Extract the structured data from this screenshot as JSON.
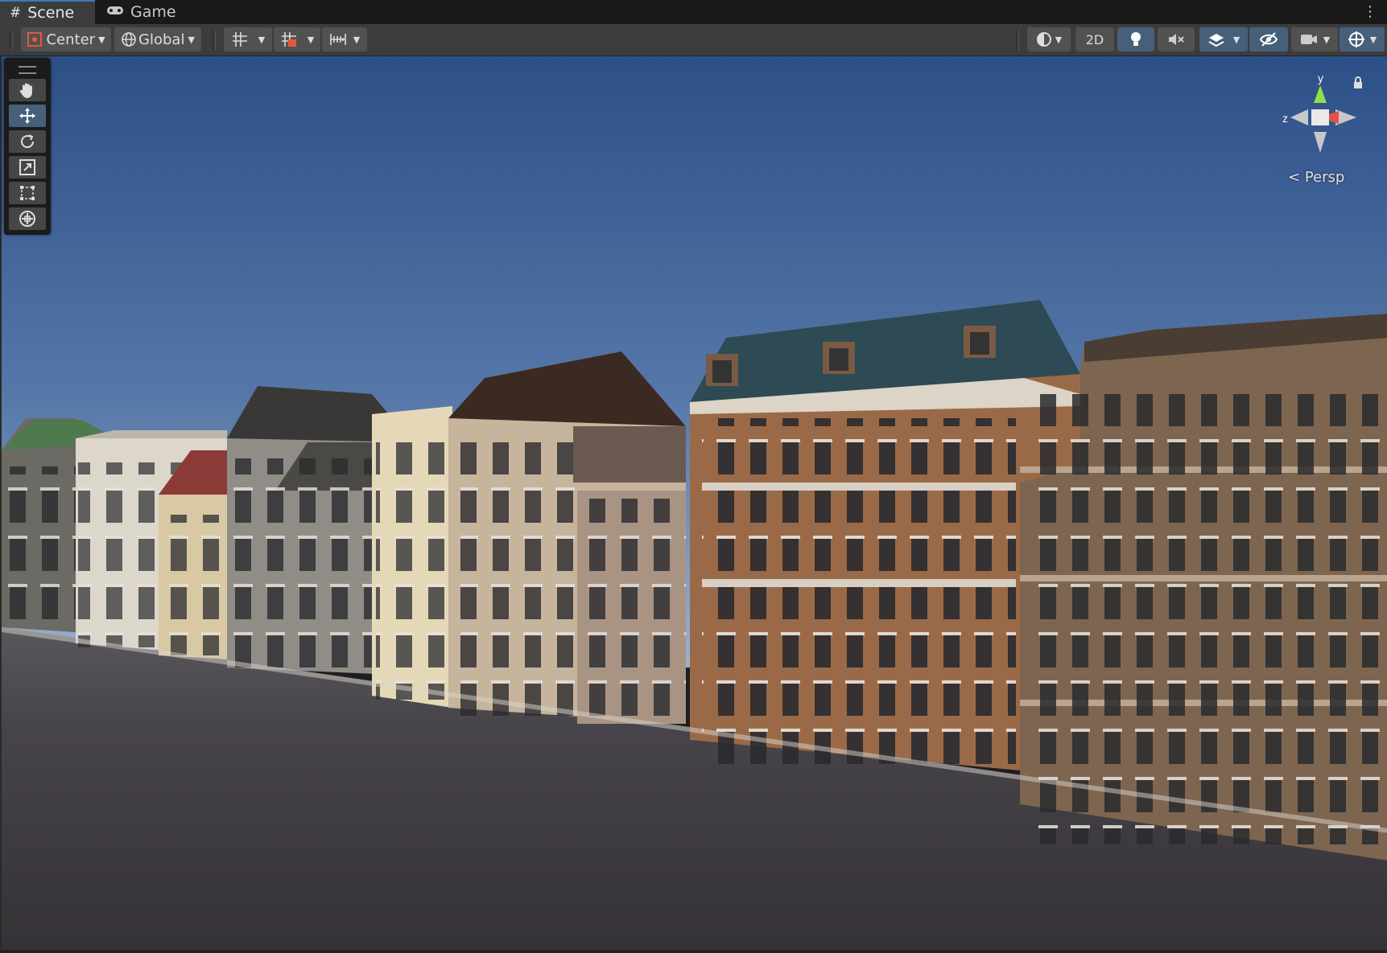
{
  "tabs": [
    {
      "label": "Scene",
      "icon": "grid-hash-icon",
      "active": true
    },
    {
      "label": "Game",
      "icon": "gamepad-icon",
      "active": false
    }
  ],
  "toolbar": {
    "pivot_mode": "Center",
    "pivot_rotation": "Global",
    "mode_2d": "2D"
  },
  "gizmo": {
    "axis_y": "y",
    "axis_z": "z",
    "projection": "Persp"
  },
  "colors": {
    "sky_top": "#2c4f87",
    "sky_bottom": "#8fa7c7",
    "ground": "#3d3a3d",
    "accent": "#46607c"
  }
}
